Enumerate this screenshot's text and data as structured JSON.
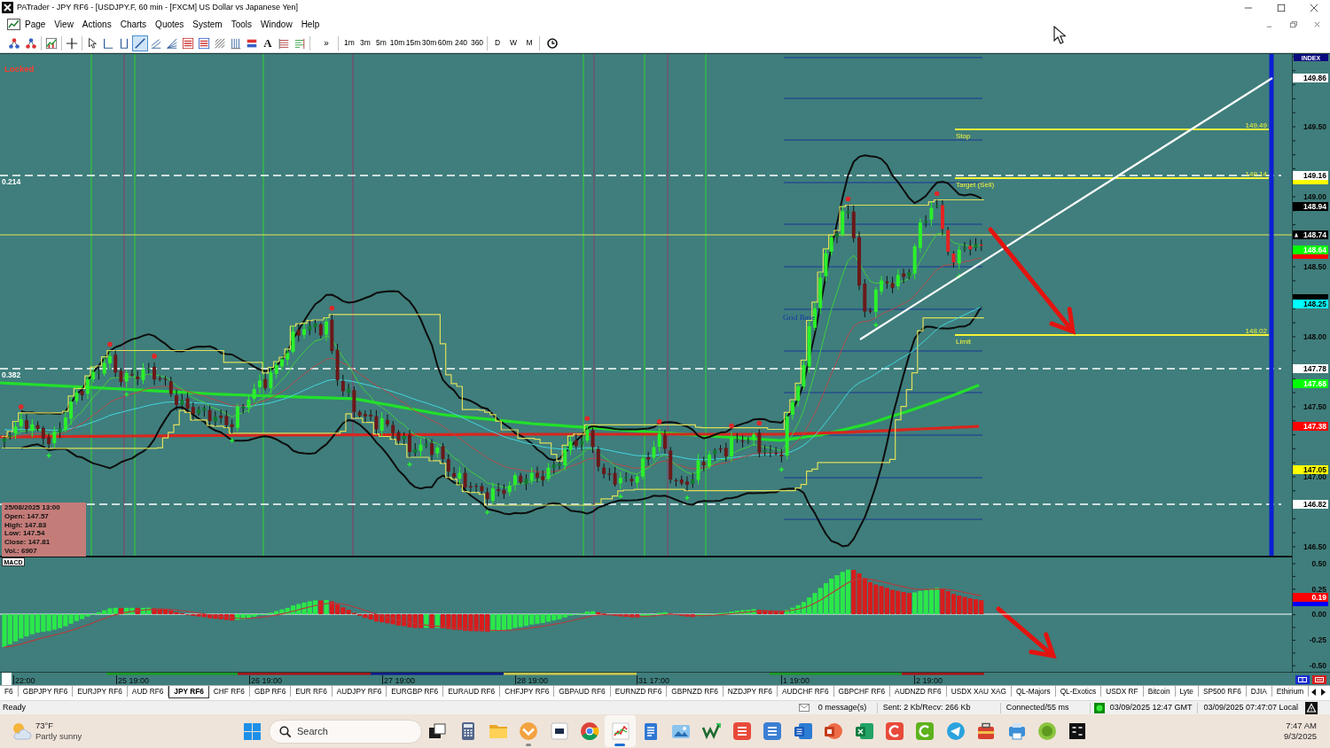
{
  "window": {
    "title": "PATrader - JPY RF6 - [USDJPY.F, 60 min - [FXCM] US Dollar vs Japanese Yen]"
  },
  "menu": [
    "Page",
    "View",
    "Actions",
    "Charts",
    "Quotes",
    "System",
    "Tools",
    "Window",
    "Help"
  ],
  "toolbar": {
    "tools": [
      {
        "kind": "nodesdown",
        "selected": false
      },
      {
        "kind": "nodesup",
        "selected": false
      },
      {
        "kind": "indicator",
        "selected": false
      },
      {
        "kind": "crosshair",
        "selected": false
      },
      {
        "kind": "pointer",
        "selected": false
      },
      {
        "kind": "hline",
        "selected": false
      },
      {
        "kind": "vline",
        "selected": false
      },
      {
        "kind": "trendline",
        "selected": true
      },
      {
        "kind": "channel",
        "selected": false
      },
      {
        "kind": "fan",
        "selected": false
      },
      {
        "kind": "retracement",
        "selected": false
      },
      {
        "kind": "expansion",
        "selected": false
      },
      {
        "kind": "gann",
        "selected": false
      },
      {
        "kind": "cycles",
        "selected": false
      },
      {
        "kind": "rectangle",
        "selected": false
      },
      {
        "kind": "text",
        "glyph": "A",
        "selected": false
      },
      {
        "kind": "timezones",
        "selected": false
      },
      {
        "kind": "arcs",
        "selected": false
      }
    ],
    "overflow": "»",
    "timeframes": [
      "1m",
      "3m",
      "5m",
      "10m",
      "15m",
      "30m",
      "60m",
      "240",
      "360"
    ],
    "periods": [
      "D",
      "W",
      "M"
    ]
  },
  "chart": {
    "status": "Locked",
    "fib_labels": [
      "0.214",
      "0.382"
    ],
    "grid_label": "Grid Base",
    "levels": [
      {
        "label": "Stop",
        "price": "149.49"
      },
      {
        "label": "Target (Sell)",
        "price": "149.14"
      },
      {
        "label": "Limit",
        "price": "148.02"
      }
    ],
    "bar_info": [
      "25/08/2025 13:00",
      "Open: 147.57",
      "High: 147.83",
      "Low: 147.54",
      "Close: 147.81",
      "Vol.: 6907"
    ],
    "price_axis": {
      "title": "INDEX",
      "ticks": [
        "149.50",
        "149.00",
        "148.50",
        "148.00",
        "147.50",
        "147.00",
        "146.50"
      ],
      "tags": [
        {
          "kind": "tag",
          "text": "149.86",
          "color": "#ffffff"
        },
        {
          "kind": "tag",
          "text": "149.16",
          "color": "#ffffff"
        },
        {
          "kind": "covered",
          "color": "#ffff00"
        },
        {
          "kind": "tag",
          "text": "148.94",
          "color": "#000000"
        },
        {
          "kind": "current",
          "text": "148.74",
          "color": "#000000"
        },
        {
          "kind": "tag",
          "text": "148.64",
          "color": "#00ff00"
        },
        {
          "kind": "covered",
          "color": "#ff0000"
        },
        {
          "kind": "covered",
          "color": "#000000"
        },
        {
          "kind": "tag",
          "text": "148.25",
          "color": "#00ffff"
        },
        {
          "kind": "tag",
          "text": "147.78",
          "color": "#ffffff"
        },
        {
          "kind": "tag",
          "text": "147.68",
          "color": "#00ff00"
        },
        {
          "kind": "tag",
          "text": "147.38",
          "color": "#ff0000"
        },
        {
          "kind": "tag",
          "text": "147.05",
          "color": "#ffff00"
        },
        {
          "kind": "tag",
          "text": "146.82",
          "color": "#ffffff"
        }
      ]
    }
  },
  "macd": {
    "label": "MACD",
    "ticks": [
      "0.50",
      "0.25",
      "0.00",
      "-0.25",
      "-0.50"
    ],
    "tags": [
      {
        "kind": "tag",
        "text": "0.19",
        "color": "#ff0000"
      },
      {
        "kind": "covered",
        "color": "#0000ff"
      }
    ]
  },
  "time_axis": [
    "22:00",
    "25 19:00",
    "26 19:00",
    "27 19:00",
    "28 19:00",
    "31 17:00",
    "1 19:00",
    "2 19:00"
  ],
  "symbol_tabs": [
    {
      "label": "F6",
      "selected": false
    },
    {
      "label": "GBPJPY RF6",
      "selected": false
    },
    {
      "label": "EURJPY RF6",
      "selected": false
    },
    {
      "label": "AUD RF6",
      "selected": false
    },
    {
      "label": "JPY RF6",
      "selected": true
    },
    {
      "label": "CHF RF6",
      "selected": false
    },
    {
      "label": "GBP RF6",
      "selected": false
    },
    {
      "label": "EUR RF6",
      "selected": false
    },
    {
      "label": "AUDJPY RF6",
      "selected": false
    },
    {
      "label": "EURGBP RF6",
      "selected": false
    },
    {
      "label": "EURAUD RF6",
      "selected": false
    },
    {
      "label": "CHFJPY RF6",
      "selected": false
    },
    {
      "label": "GBPAUD RF6",
      "selected": false
    },
    {
      "label": "EURNZD RF6",
      "selected": false
    },
    {
      "label": "GBPNZD RF6",
      "selected": false
    },
    {
      "label": "NZDJPY RF6",
      "selected": false
    },
    {
      "label": "AUDCHF RF6",
      "selected": false
    },
    {
      "label": "GBPCHF RF6",
      "selected": false
    },
    {
      "label": "AUDNZD RF6",
      "selected": false
    },
    {
      "label": "USDX XAU XAG",
      "selected": false
    },
    {
      "label": "QL-Majors",
      "selected": false
    },
    {
      "label": "QL-Exotics",
      "selected": false
    },
    {
      "label": "USDX RF",
      "selected": false
    },
    {
      "label": "Bitcoin",
      "selected": false
    },
    {
      "label": "Lyte",
      "selected": false
    },
    {
      "label": "SP500 RF6",
      "selected": false
    },
    {
      "label": "DJIA",
      "selected": false
    },
    {
      "label": "Ethirium",
      "selected": false
    }
  ],
  "status_bar": {
    "state": "Ready",
    "messages": "0 message(s)",
    "traffic": "Sent: 2 Kb/Recv: 266 Kb",
    "connection": "Connected/55 ms",
    "connected": true,
    "gmt_time": "03/09/2025 12:47 GMT",
    "local_time": "03/09/2025 07:47:07 Local"
  },
  "taskbar": {
    "weather": {
      "temperature": "73°F",
      "condition": "Partly sunny"
    },
    "search": {
      "placeholder": "Search"
    },
    "apps": [
      {
        "kind": "taskview",
        "selected": false,
        "running": false
      },
      {
        "kind": "calculator",
        "selected": false,
        "running": false
      },
      {
        "kind": "folder",
        "selected": false,
        "running": false
      },
      {
        "kind": "mail",
        "selected": false,
        "running": true
      },
      {
        "kind": "tile",
        "selected": false,
        "running": false
      },
      {
        "kind": "chrome",
        "selected": false,
        "running": false
      },
      {
        "kind": "chart",
        "selected": true,
        "running": true
      },
      {
        "kind": "notepad",
        "selected": false,
        "running": false
      },
      {
        "kind": "photos",
        "selected": false,
        "running": false
      },
      {
        "kind": "zigzag",
        "selected": false,
        "running": false
      },
      {
        "kind": "sred",
        "selected": false,
        "running": false
      },
      {
        "kind": "sblue",
        "selected": false,
        "running": false
      },
      {
        "kind": "word",
        "selected": false,
        "running": false
      },
      {
        "kind": "powerpoint",
        "selected": false,
        "running": false
      },
      {
        "kind": "excel",
        "selected": false,
        "running": false
      },
      {
        "kind": "cred",
        "selected": false,
        "running": false
      },
      {
        "kind": "cgreen",
        "selected": false,
        "running": false
      },
      {
        "kind": "telegram",
        "selected": false,
        "running": false
      },
      {
        "kind": "toolbox",
        "selected": false,
        "running": false
      },
      {
        "kind": "printer",
        "selected": false,
        "running": false
      },
      {
        "kind": "wgreen",
        "selected": false,
        "running": false
      },
      {
        "kind": "sm",
        "selected": false,
        "running": false
      }
    ],
    "clock": {
      "time": "7:47 AM",
      "date": "9/3/2025"
    }
  }
}
